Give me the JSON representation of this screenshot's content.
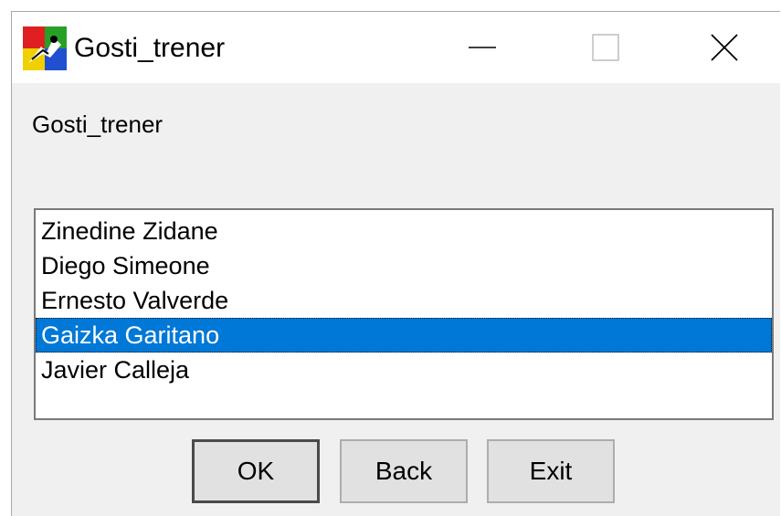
{
  "window": {
    "title": "Gosti_trener",
    "icon": "app-icon",
    "controls": {
      "minimize_icon": "minimize-icon",
      "maximize_icon": "maximize-icon",
      "close_icon": "close-icon"
    }
  },
  "content": {
    "label": "Gosti_trener",
    "list": {
      "items": [
        {
          "label": "Zinedine Zidane"
        },
        {
          "label": "Diego Simeone"
        },
        {
          "label": "Ernesto Valverde"
        },
        {
          "label": "Gaizka Garitano"
        },
        {
          "label": "Javier Calleja"
        }
      ],
      "selected_index": 3
    },
    "buttons": {
      "ok": "OK",
      "back": "Back",
      "exit": "Exit"
    }
  },
  "colors": {
    "selection": "#0078d7",
    "window_bg": "#f0f0f0",
    "titlebar_bg": "#ffffff"
  }
}
